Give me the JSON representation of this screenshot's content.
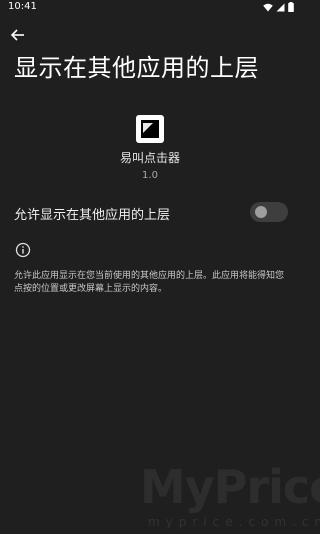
{
  "status_bar": {
    "time": "10:41",
    "icons": [
      "wifi-icon",
      "signal-icon",
      "battery-icon"
    ]
  },
  "header": {
    "back_icon": "arrow-back-icon",
    "title": "显示在其他应用的上层"
  },
  "app": {
    "icon": "app-logo-icon",
    "name": "易叫点击器",
    "version": "1.0"
  },
  "setting": {
    "label": "允许显示在其他应用的上层",
    "enabled": false
  },
  "info": {
    "icon": "info-icon",
    "description": "允许此应用显示在您当前使用的其他应用的上层。此应用将能得知您点按的位置或更改屏幕上显示的内容。"
  },
  "watermark": {
    "text": "MyPrice",
    "sub": "myprice.com.cn"
  },
  "colors": {
    "background": "#1f1f1f",
    "toggle_track": "#3e3e3e",
    "toggle_thumb": "#9e9e9e"
  }
}
